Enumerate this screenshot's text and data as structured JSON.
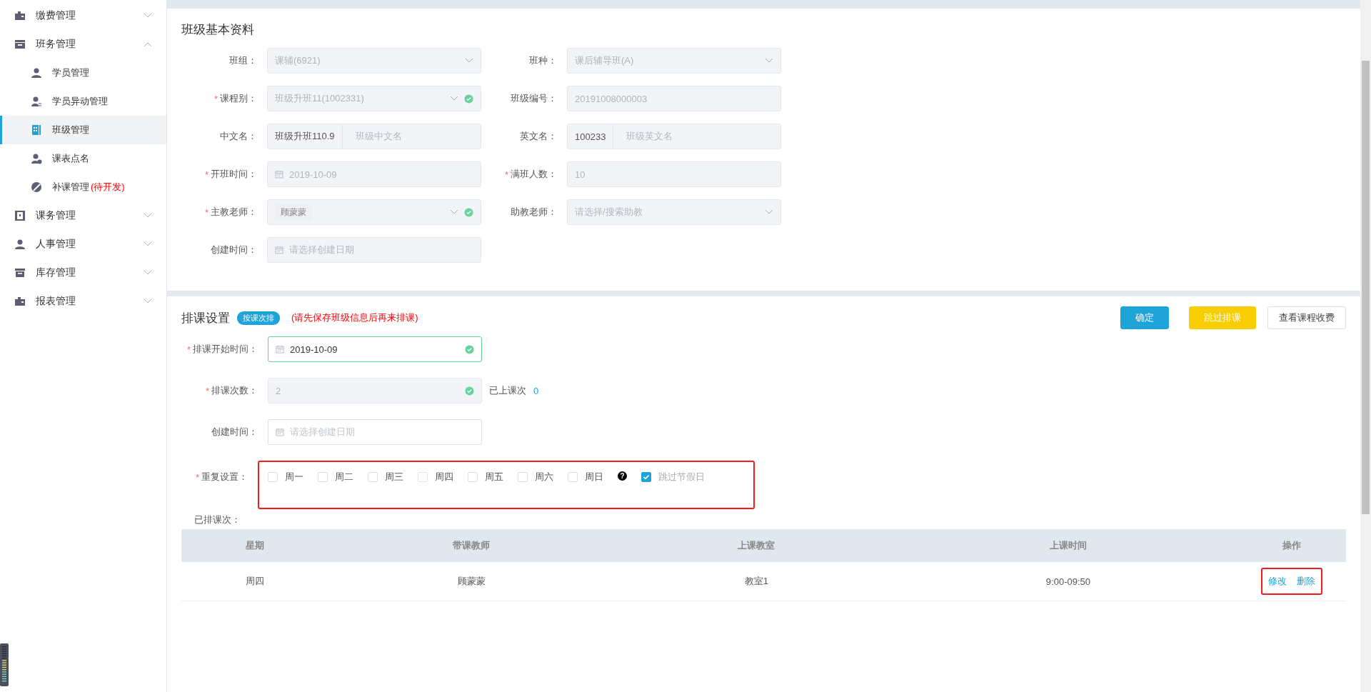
{
  "sidebar": {
    "groups": [
      {
        "label": "缴费管理",
        "expanded": false
      },
      {
        "label": "班务管理",
        "expanded": true,
        "children": [
          {
            "label": "学员管理",
            "selected": false
          },
          {
            "label": "学员异动管理",
            "selected": false
          },
          {
            "label": "班级管理",
            "selected": true
          },
          {
            "label": "课表点名",
            "selected": false
          },
          {
            "label": "补课管理",
            "note": "(待开发)",
            "selected": false
          }
        ]
      },
      {
        "label": "课务管理",
        "expanded": false
      },
      {
        "label": "人事管理",
        "expanded": false
      },
      {
        "label": "库存管理",
        "expanded": false
      },
      {
        "label": "报表管理",
        "expanded": false
      }
    ]
  },
  "basic_info": {
    "title": "班级基本资料",
    "fields": [
      {
        "label": "班组：",
        "kind": "select",
        "value": "课辅(6921)",
        "disabled": true
      },
      {
        "label": "班种：",
        "kind": "select",
        "value": "课后辅导班(A)",
        "disabled": true
      },
      {
        "label": "课程别：",
        "kind": "select",
        "required_mark": "*",
        "value": "班级升班11(1002331)",
        "disabled": true,
        "valid": true
      },
      {
        "label": "班级编号：",
        "kind": "text",
        "value": "20191008000003",
        "disabled": true
      },
      {
        "label": "中文名：",
        "kind": "prefixed",
        "prefix": "班级升班110.9",
        "placeholder": "班级中文名",
        "disabled": true
      },
      {
        "label": "英文名：",
        "kind": "prefixed",
        "prefix": "100233",
        "placeholder": "班级英文名",
        "disabled": true
      },
      {
        "label": "开班时间：",
        "kind": "date",
        "required_mark": "*",
        "value": "2019-10-09",
        "disabled": true
      },
      {
        "label": "满班人数：",
        "kind": "text",
        "required_mark": "*",
        "value": "10",
        "disabled": true
      },
      {
        "label": "主教老师：",
        "kind": "tag",
        "required_mark": "*",
        "value": "顾蒙蒙",
        "disabled": true,
        "valid": true
      },
      {
        "label": "助教老师：",
        "kind": "select",
        "placeholder": "请选择/搜索助教",
        "disabled": true
      },
      {
        "label": "创建时间：",
        "kind": "date",
        "placeholder": "请选择创建日期",
        "disabled": true
      }
    ]
  },
  "schedule": {
    "title": "排课设置",
    "badge": "按课次排",
    "warning": "(请先保存班级信息后再来排课)",
    "buttons": [
      {
        "label": "确定",
        "kind": "primary"
      },
      {
        "label": "跳过排课",
        "kind": "warning"
      },
      {
        "label": "查看课程收费",
        "kind": "default"
      }
    ],
    "fields": [
      {
        "label": "排课开始时间：",
        "kind": "date",
        "required_mark": "*",
        "value": "2019-10-09",
        "disabled": false,
        "valid": true
      },
      {
        "label": "排课次数：",
        "kind": "text",
        "required_mark": "*",
        "value": "2",
        "disabled": true,
        "valid": true,
        "extra_label": "已上课次",
        "extra_value": "0"
      },
      {
        "label": "创建时间：",
        "kind": "date",
        "placeholder": "请选择创建日期",
        "disabled": false
      }
    ],
    "repeat": {
      "label": "重复设置：",
      "required_mark": "*",
      "highlighted": true,
      "days": [
        {
          "label": "周一",
          "checked": false
        },
        {
          "label": "周二",
          "checked": false
        },
        {
          "label": "周三",
          "checked": false
        },
        {
          "label": "周四",
          "checked": false
        },
        {
          "label": "周五",
          "checked": false
        },
        {
          "label": "周六",
          "checked": false
        },
        {
          "label": "周日",
          "checked": false
        }
      ],
      "help": "?",
      "skip_holidays": {
        "label": "跳过节假日",
        "checked": true
      }
    },
    "scheduled_label": "已排课次：",
    "table": {
      "columns": [
        "星期",
        "带课教师",
        "上课教室",
        "上课时间",
        "操作"
      ],
      "rows": [
        {
          "cells": [
            "周四",
            "顾蒙蒙",
            "教室1",
            "9:00-09:50"
          ],
          "actions": [
            "修改",
            "删除"
          ],
          "actions_highlighted": true
        }
      ]
    }
  }
}
